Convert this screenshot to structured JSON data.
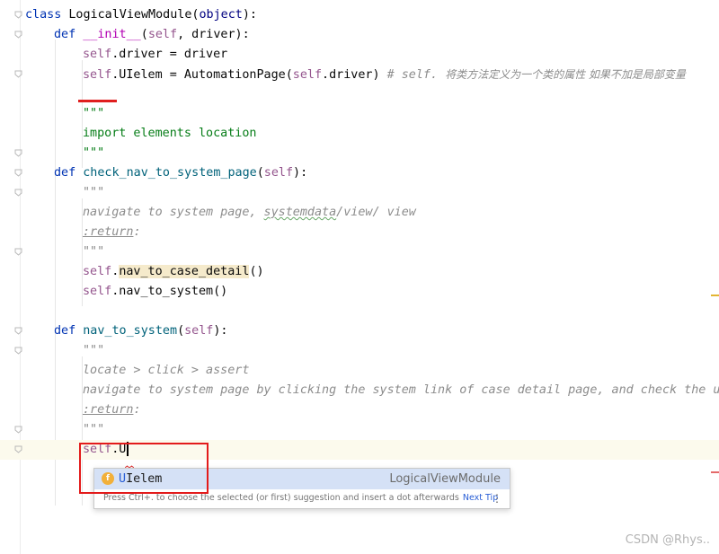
{
  "editor": {
    "lines": [
      {
        "segs": [
          [
            "kw",
            "class "
          ],
          [
            "plain",
            "LogicalViewModule("
          ],
          [
            "builtin",
            "object"
          ],
          [
            "plain",
            "):"
          ]
        ]
      },
      {
        "segs": [
          [
            "kw",
            "def "
          ],
          [
            "magic",
            "__init__"
          ],
          [
            "plain",
            "("
          ],
          [
            "self",
            "self"
          ],
          [
            "plain",
            ", driver):"
          ]
        ]
      },
      {
        "segs": [
          [
            "self",
            "self"
          ],
          [
            "plain",
            ".driver = driver"
          ]
        ]
      },
      {
        "segs": [
          [
            "self",
            "self"
          ],
          [
            "plain",
            ".UIelem = AutomationPage("
          ],
          [
            "self",
            "self"
          ],
          [
            "plain",
            ".driver) "
          ],
          [
            "cmt",
            "# self. "
          ],
          [
            "cmtcn",
            "将类方法定义为一个类的属性 如果不加是局部变量"
          ]
        ]
      },
      {
        "segs": []
      },
      {
        "segs": [
          [
            "str",
            "\"\"\""
          ]
        ]
      },
      {
        "segs": [
          [
            "str",
            "import elements location"
          ]
        ]
      },
      {
        "segs": [
          [
            "str",
            "\"\"\""
          ]
        ]
      },
      {
        "segs": [
          [
            "kw",
            "def "
          ],
          [
            "fn",
            "check_nav_to_system_page"
          ],
          [
            "plain",
            "("
          ],
          [
            "self",
            "self"
          ],
          [
            "plain",
            "):"
          ]
        ]
      },
      {
        "segs": [
          [
            "doc",
            "\"\"\""
          ]
        ]
      },
      {
        "segs": [
          [
            "doc",
            "navigate to system page, "
          ],
          [
            "docwavy",
            "systemdata"
          ],
          [
            "doc",
            "/view/ view"
          ]
        ]
      },
      {
        "segs": [
          [
            "docul",
            ":return"
          ],
          [
            "doc",
            ":"
          ]
        ]
      },
      {
        "segs": [
          [
            "doc",
            "\"\"\""
          ]
        ]
      },
      {
        "segs": [
          [
            "self",
            "self"
          ],
          [
            "plain",
            "."
          ],
          [
            "hl",
            "nav_to_case_detail"
          ],
          [
            "plain",
            "()"
          ]
        ]
      },
      {
        "segs": [
          [
            "self",
            "self"
          ],
          [
            "plain",
            ".nav_to_system()"
          ]
        ]
      },
      {
        "segs": []
      },
      {
        "segs": [
          [
            "kw",
            "def "
          ],
          [
            "fn",
            "nav_to_system"
          ],
          [
            "plain",
            "("
          ],
          [
            "self",
            "self"
          ],
          [
            "plain",
            "):"
          ]
        ]
      },
      {
        "segs": [
          [
            "doc",
            "\"\"\""
          ]
        ]
      },
      {
        "segs": [
          [
            "doc",
            "locate > click > assert"
          ]
        ]
      },
      {
        "segs": [
          [
            "doc",
            "navigate to system page by clicking the system link of case detail page, and check the url"
          ]
        ]
      },
      {
        "segs": [
          [
            "docul",
            ":return"
          ],
          [
            "doc",
            ":"
          ]
        ]
      },
      {
        "segs": [
          [
            "doc",
            "\"\"\""
          ]
        ]
      },
      {
        "segs": [
          [
            "self",
            "self"
          ],
          [
            "plain",
            ".U"
          ]
        ]
      }
    ]
  },
  "completion": {
    "badge": "f",
    "match": "U",
    "rest": "Ielem",
    "type": "LogicalViewModule",
    "hint": "Press Ctrl+. to choose the selected (or first) suggestion and insert a dot afterwards",
    "next_tip": "Next Tip",
    "menu_icon": "kebab-menu-icon"
  },
  "watermark": "CSDN @Rhys..",
  "colors": {
    "keyword": "#0033b3",
    "self": "#94558d",
    "function": "#00627a",
    "string": "#067d17",
    "comment": "#8c8c8c",
    "annotation_red": "#e31b1b",
    "popup_selection": "#d5e1f6"
  }
}
